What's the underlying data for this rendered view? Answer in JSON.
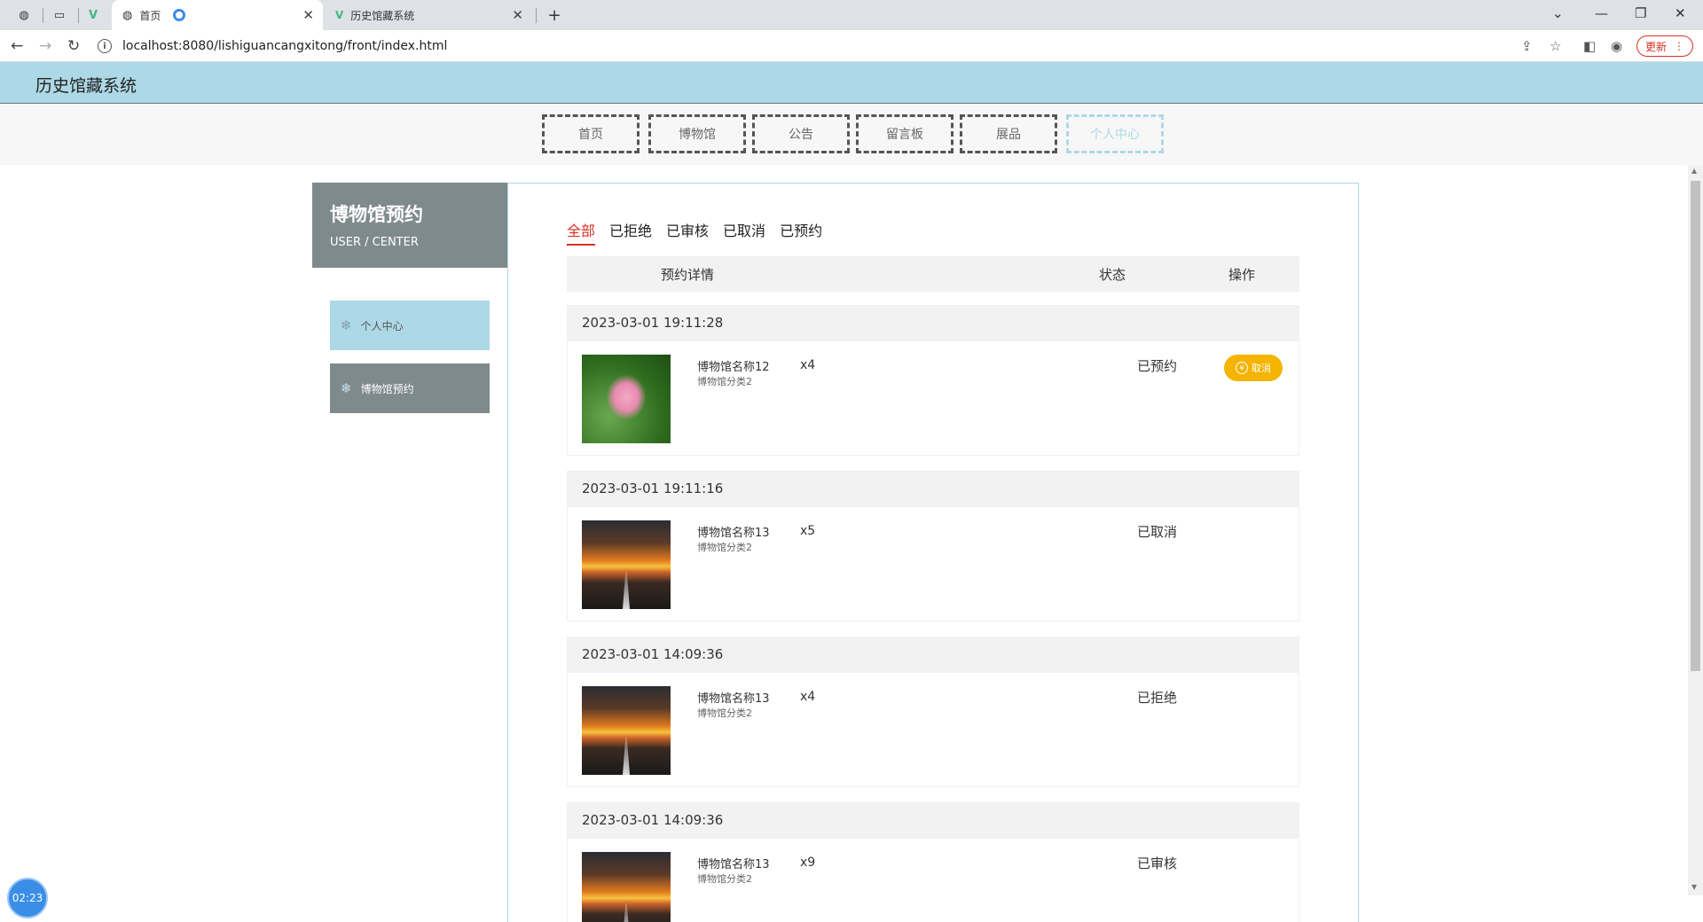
{
  "browser": {
    "tabs": [
      {
        "title": "首页",
        "active": true
      },
      {
        "title": "历史馆藏系统",
        "active": false
      }
    ],
    "url": "localhost:8080/lishiguancangxitong/front/index.html",
    "update_label": "更新"
  },
  "site": {
    "title": "历史馆藏系统",
    "nav": [
      "首页",
      "博物馆",
      "公告",
      "留言板",
      "展品",
      "个人中心"
    ],
    "active_nav": "个人中心"
  },
  "sidebar": {
    "title": "博物馆预约",
    "subtitle": "USER / CENTER",
    "items": [
      "个人中心",
      "博物馆预约"
    ]
  },
  "filters": {
    "items": [
      "全部",
      "已拒绝",
      "已审核",
      "已取消",
      "已预约"
    ],
    "active": "全部"
  },
  "table": {
    "headers": {
      "detail": "预约详情",
      "status": "状态",
      "action": "操作"
    }
  },
  "orders": [
    {
      "time": "2023-03-01 19:11:28",
      "name": "博物馆名称12",
      "category": "博物馆分类2",
      "qty": "x4",
      "status": "已预约",
      "action": "取消",
      "image": "lotus"
    },
    {
      "time": "2023-03-01 19:11:16",
      "name": "博物馆名称13",
      "category": "博物馆分类2",
      "qty": "x5",
      "status": "已取消",
      "action": "",
      "image": "sunset-road"
    },
    {
      "time": "2023-03-01 14:09:36",
      "name": "博物馆名称13",
      "category": "博物馆分类2",
      "qty": "x4",
      "status": "已拒绝",
      "action": "",
      "image": "sunset-road"
    },
    {
      "time": "2023-03-01 14:09:36",
      "name": "博物馆名称13",
      "category": "博物馆分类2",
      "qty": "x9",
      "status": "已审核",
      "action": "",
      "image": "sunset-road"
    }
  ],
  "timer": "02:23",
  "colors": {
    "header": "#add8e6",
    "accent_red": "#d93025",
    "cancel_button": "#f5b400",
    "sidebar_dark": "#7f8a8d"
  }
}
